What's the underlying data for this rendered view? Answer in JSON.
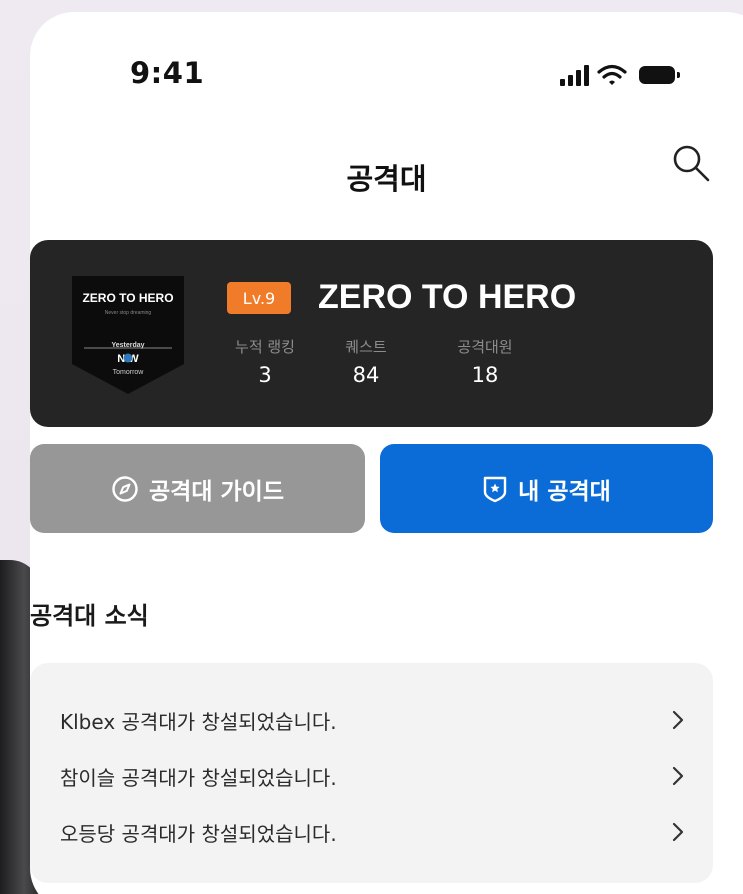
{
  "status_bar": {
    "time": "9:41",
    "icons": [
      "signal-icon",
      "wifi-icon",
      "battery-icon"
    ]
  },
  "header": {
    "title": "공격대",
    "search_icon": "search-icon"
  },
  "squad": {
    "emblem": {
      "title": "ZERO TO HERO",
      "subtitle": "Never stop dreaming",
      "line1": "Yesterday",
      "line2": "N  W",
      "line3": "Tomorrow"
    },
    "level": "Lv.9",
    "name": "ZERO TO HERO",
    "stats": [
      {
        "label": "누적 랭킹",
        "value": "3"
      },
      {
        "label": "퀘스트",
        "value": "84"
      },
      {
        "label": "공격대원",
        "value": "18"
      }
    ]
  },
  "buttons": {
    "guide_label": "공격대 가이드",
    "my_label": "내 공격대"
  },
  "news": {
    "title": "공격대 소식",
    "items": [
      {
        "text": "Klbex 공격대가 창설되었습니다."
      },
      {
        "text": "참이슬 공격대가 창설되었습니다."
      },
      {
        "text": "오등당 공격대가 창설되었습니다."
      }
    ]
  },
  "colors": {
    "card_bg": "#252525",
    "level_badge": "#f07c2a",
    "guide_button": "#979797",
    "my_button": "#0b6cd8",
    "news_bg": "#f3f3f3"
  }
}
